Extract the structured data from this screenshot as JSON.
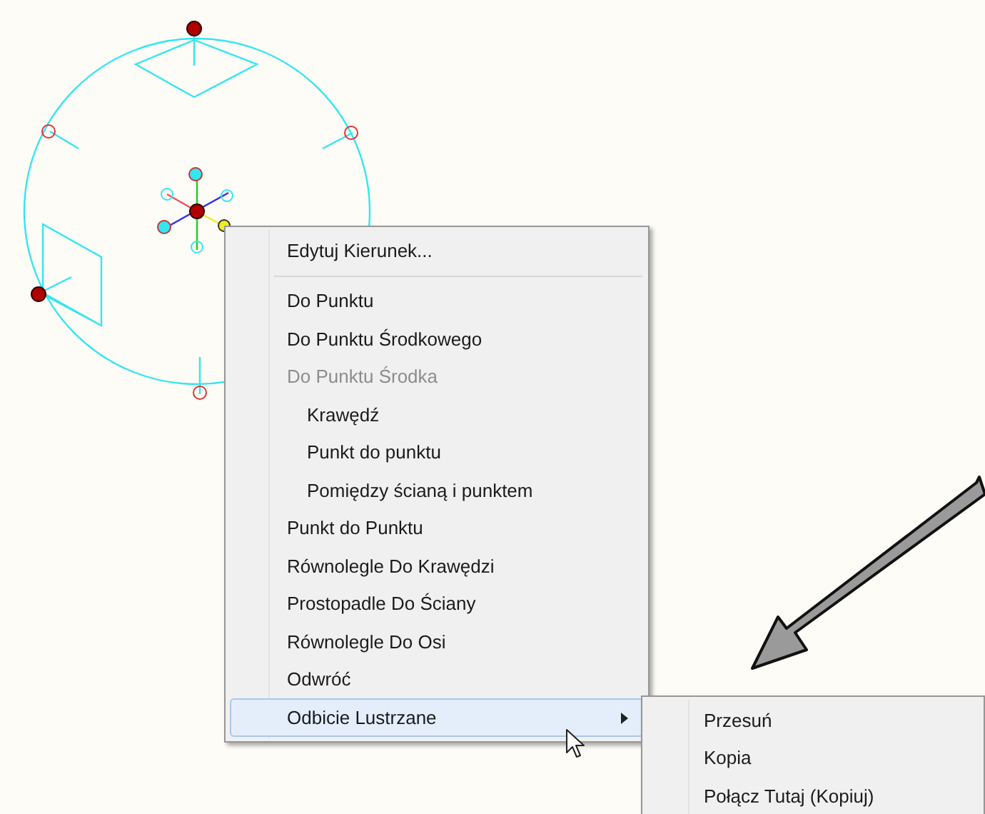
{
  "context_menu": {
    "items": [
      {
        "kind": "item",
        "label": "Edytuj Kierunek...",
        "disabled": false,
        "selected": false
      },
      {
        "kind": "separator"
      },
      {
        "kind": "item",
        "label": "Do Punktu",
        "disabled": false,
        "selected": false
      },
      {
        "kind": "item",
        "label": "Do Punktu Środkowego",
        "disabled": false,
        "selected": false
      },
      {
        "kind": "item",
        "label": "Do Punktu Środka",
        "disabled": true,
        "selected": false,
        "children": [
          {
            "kind": "item",
            "label": "Krawędź",
            "disabled": false,
            "selected": false
          },
          {
            "kind": "item",
            "label": "Punkt do punktu",
            "disabled": false,
            "selected": false
          },
          {
            "kind": "item",
            "label": "Pomiędzy ścianą i punktem",
            "disabled": false,
            "selected": false
          }
        ]
      },
      {
        "kind": "item",
        "label": "Punkt do Punktu",
        "disabled": false,
        "selected": false
      },
      {
        "kind": "item",
        "label": "Równolegle Do Krawędzi",
        "disabled": false,
        "selected": false
      },
      {
        "kind": "item",
        "label": "Prostopadle Do Ściany",
        "disabled": false,
        "selected": false
      },
      {
        "kind": "item",
        "label": "Równolegle Do Osi",
        "disabled": false,
        "selected": false
      },
      {
        "kind": "item",
        "label": "Odwróć",
        "disabled": false,
        "selected": false
      },
      {
        "kind": "item",
        "label": "Odbicie Lustrzane",
        "disabled": false,
        "selected": true,
        "has_submenu": true
      }
    ]
  },
  "submenu": {
    "items": [
      {
        "kind": "item",
        "label": "Przesuń",
        "disabled": false,
        "selected": false
      },
      {
        "kind": "item",
        "label": "Kopia",
        "disabled": false,
        "selected": false
      },
      {
        "kind": "item",
        "label": "Połącz Tutaj (Kopiuj)",
        "disabled": false,
        "selected": false
      }
    ]
  }
}
